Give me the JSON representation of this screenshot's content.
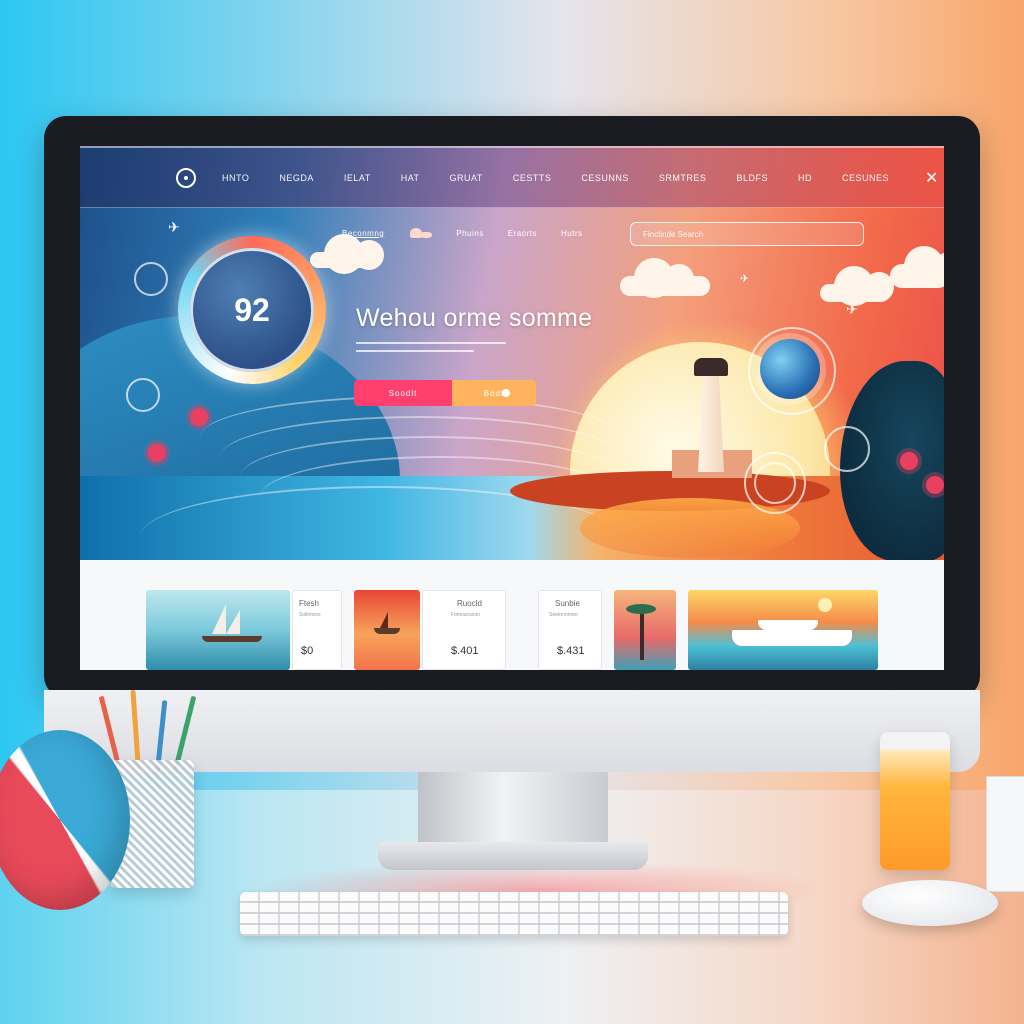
{
  "navbar": {
    "items": [
      "Hnto",
      "Negda",
      "Ielat",
      "Hat",
      "Gruat",
      "Cestts",
      "Cesunns",
      "Srmtres",
      "Bldfs",
      "Hd",
      "Cesunes"
    ]
  },
  "subnav": {
    "items": [
      "Beconmng",
      "Phuins",
      "Eraorts",
      "Hutrs"
    ]
  },
  "search": {
    "placeholder": "Finctinde Search"
  },
  "score": {
    "value": "92"
  },
  "hero": {
    "title": "Wehou orme somme",
    "primary_button": "Soodlt",
    "secondary_button": "Bodt"
  },
  "cards": [
    {
      "title": "Ftesh",
      "subtitle": "Sollimons",
      "price": "$0"
    },
    {
      "title": "Ruocld",
      "subtitle": "Fomourssion",
      "price": "$.401"
    },
    {
      "title": "Sunbie",
      "subtitle": "Seetonnrnee",
      "price": "$.431"
    }
  ],
  "colors": {
    "accent_pink": "#ff3f6e",
    "accent_orange": "#ffb35c",
    "nav_start": "#1c3a6e",
    "nav_end": "#ec5046"
  }
}
